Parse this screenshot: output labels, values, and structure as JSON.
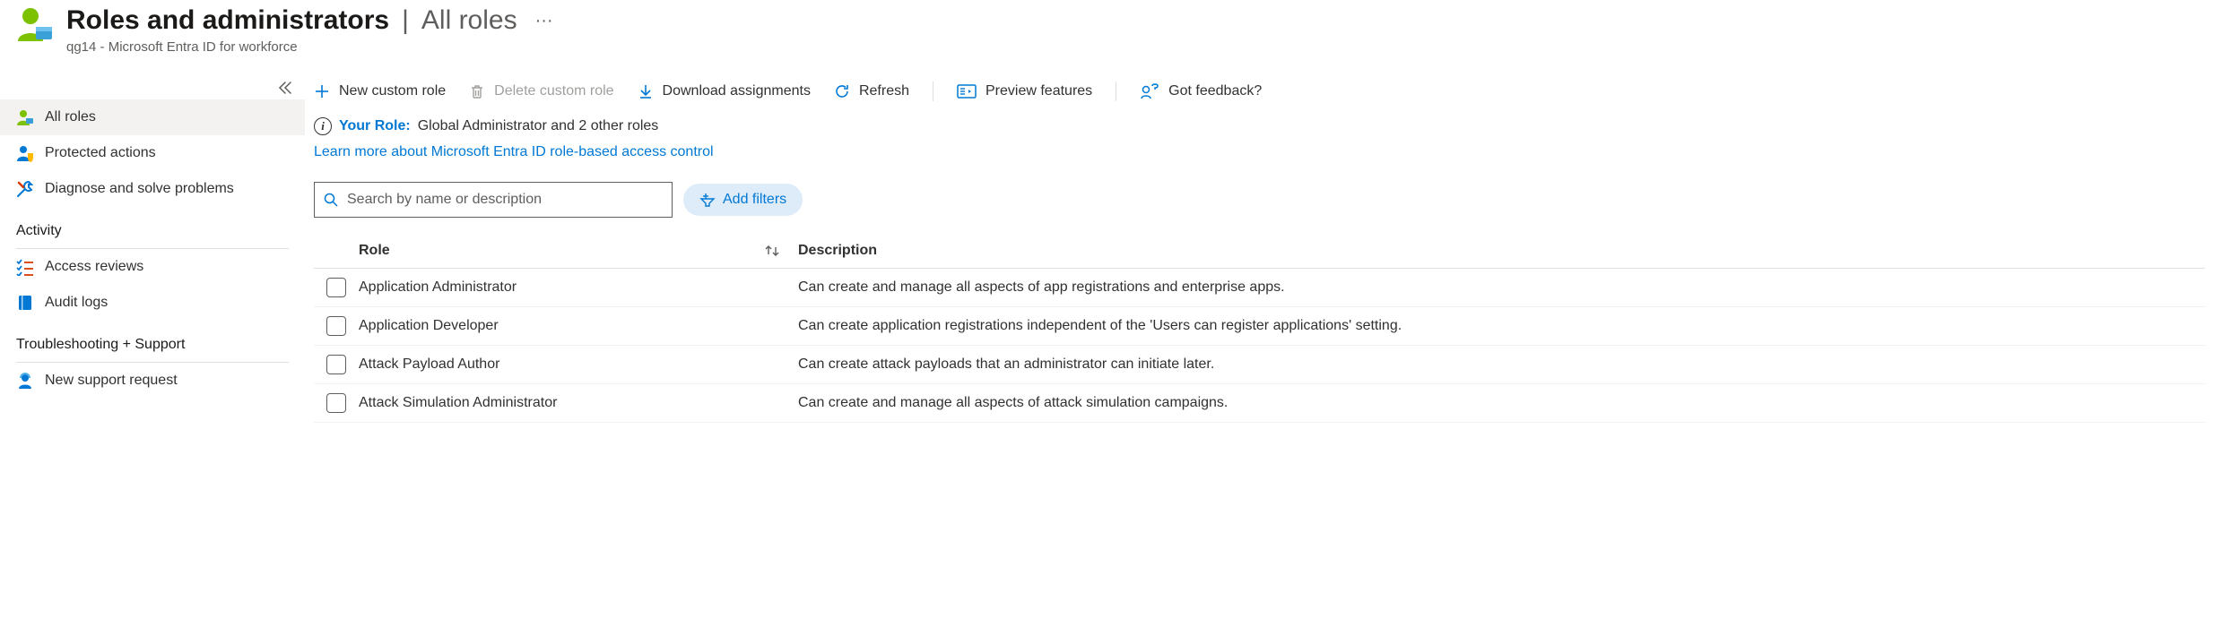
{
  "header": {
    "title": "Roles and administrators",
    "separator": "|",
    "subtitle": "All roles",
    "breadcrumb": "qg14 - Microsoft Entra ID for workforce"
  },
  "sidebar": {
    "items": [
      {
        "label": "All roles",
        "icon": "person-green",
        "selected": true
      },
      {
        "label": "Protected actions",
        "icon": "person-shield",
        "selected": false
      },
      {
        "label": "Diagnose and solve problems",
        "icon": "wrench",
        "selected": false
      }
    ],
    "activity_title": "Activity",
    "activity_items": [
      {
        "label": "Access reviews",
        "icon": "checklist"
      },
      {
        "label": "Audit logs",
        "icon": "book"
      }
    ],
    "support_title": "Troubleshooting + Support",
    "support_items": [
      {
        "label": "New support request",
        "icon": "support-person"
      }
    ]
  },
  "toolbar": {
    "new_custom_role": "New custom role",
    "delete_custom_role": "Delete custom role",
    "download_assignments": "Download assignments",
    "refresh": "Refresh",
    "preview_features": "Preview features",
    "got_feedback": "Got feedback?"
  },
  "info": {
    "label": "Your Role:",
    "value": "Global Administrator and 2 other roles"
  },
  "learn_more": "Learn more about Microsoft Entra ID role-based access control",
  "search": {
    "placeholder": "Search by name or description"
  },
  "filters": {
    "add_label": "Add filters"
  },
  "table": {
    "headers": {
      "role": "Role",
      "description": "Description"
    },
    "rows": [
      {
        "role": "Application Administrator",
        "description": "Can create and manage all aspects of app registrations and enterprise apps."
      },
      {
        "role": "Application Developer",
        "description": "Can create application registrations independent of the 'Users can register applications' setting."
      },
      {
        "role": "Attack Payload Author",
        "description": "Can create attack payloads that an administrator can initiate later."
      },
      {
        "role": "Attack Simulation Administrator",
        "description": "Can create and manage all aspects of attack simulation campaigns."
      }
    ]
  }
}
